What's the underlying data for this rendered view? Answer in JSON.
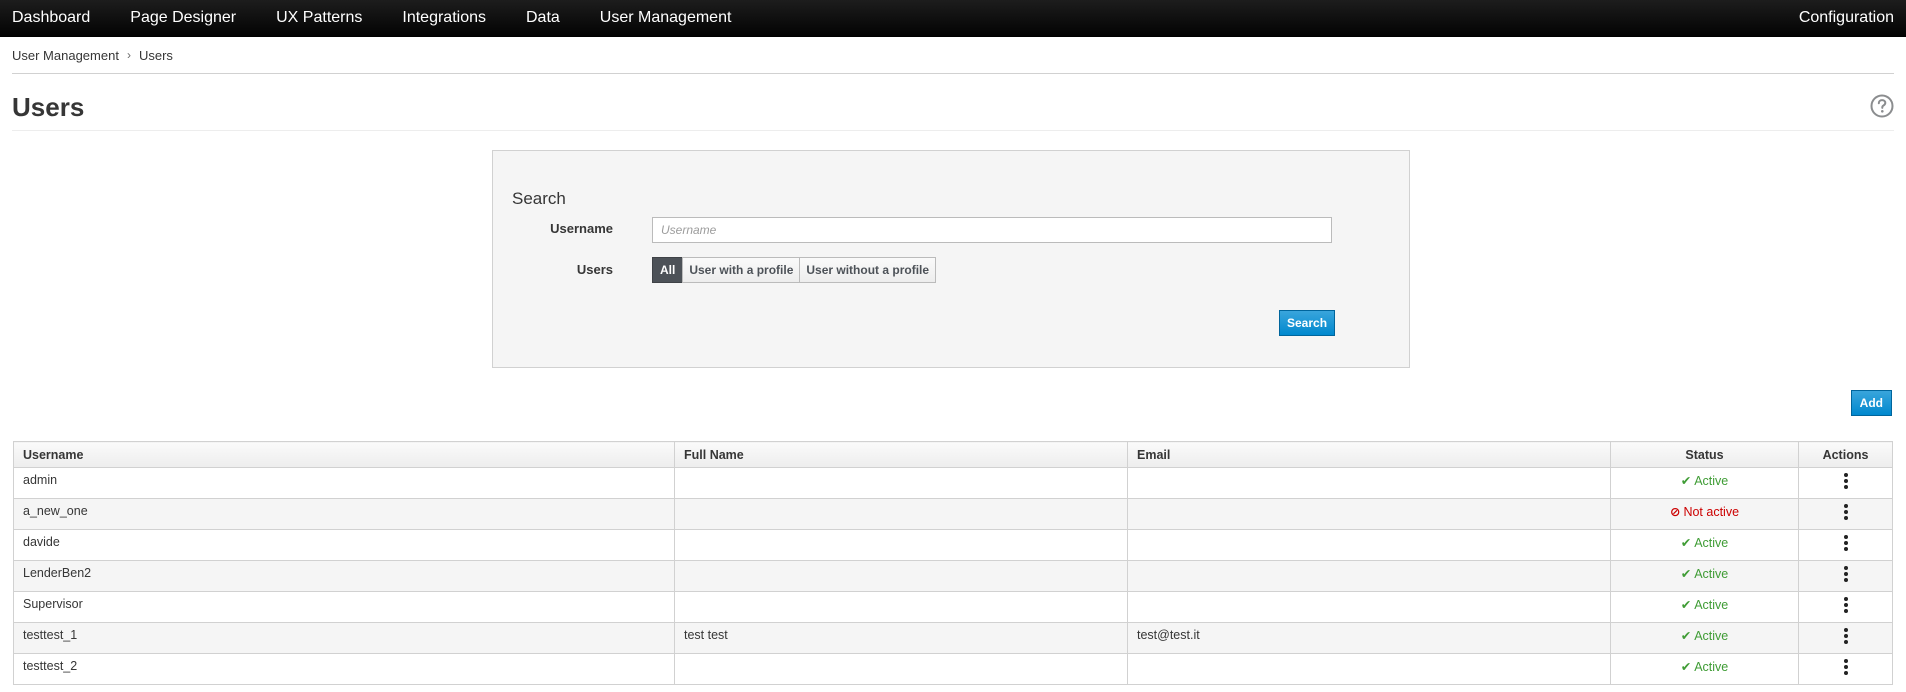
{
  "topnav": {
    "items": [
      "Dashboard",
      "Page Designer",
      "UX Patterns",
      "Integrations",
      "Data",
      "User Management"
    ],
    "right": "Configuration"
  },
  "breadcrumb": {
    "parent": "User Management",
    "current": "Users",
    "separator": "›"
  },
  "page": {
    "title": "Users",
    "help_icon": "question-circle-icon"
  },
  "search": {
    "heading": "Search",
    "username_label": "Username",
    "username_placeholder": "Username",
    "username_value": "",
    "users_label": "Users",
    "filters": [
      "All",
      "User with a profile",
      "User without a profile"
    ],
    "selected_filter": "All",
    "search_button": "Search"
  },
  "actions": {
    "add_button": "Add"
  },
  "table": {
    "headers": {
      "username": "Username",
      "fullname": "Full Name",
      "email": "Email",
      "status": "Status",
      "actions": "Actions"
    },
    "rows": [
      {
        "username": "admin",
        "fullname": "",
        "email": "",
        "status": "Active",
        "active": true
      },
      {
        "username": "a_new_one",
        "fullname": "",
        "email": "",
        "status": "Not active",
        "active": false
      },
      {
        "username": "davide",
        "fullname": "",
        "email": "",
        "status": "Active",
        "active": true
      },
      {
        "username": "LenderBen2",
        "fullname": "",
        "email": "",
        "status": "Active",
        "active": true
      },
      {
        "username": "Supervisor",
        "fullname": "",
        "email": "",
        "status": "Active",
        "active": true
      },
      {
        "username": "testtest_1",
        "fullname": "test test",
        "email": "test@test.it",
        "status": "Active",
        "active": true
      },
      {
        "username": "testtest_2",
        "fullname": "",
        "email": "",
        "status": "Active",
        "active": true
      }
    ]
  },
  "colors": {
    "active": "#3f9c35",
    "inactive": "#cc0000",
    "primary": "#0088ce",
    "nav_bg": "#030303"
  }
}
